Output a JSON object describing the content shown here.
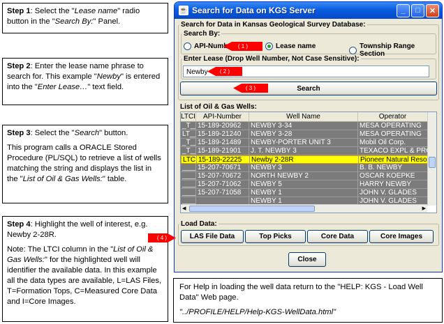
{
  "notes": {
    "step1": {
      "label": "Step 1",
      "text_a": ": Select the \"",
      "em1": "Lease name",
      "text_b": "\" radio button in the \"",
      "em2": "Search By:",
      "text_c": "\" Panel."
    },
    "step2": {
      "label": "Step 2",
      "text_a": ": Enter the lease name phrase to search for. This example \"",
      "em1": "Newby",
      "text_b": "\" is entered into the \"",
      "em2": "Enter Lease…",
      "text_c": "\" text field."
    },
    "step3": {
      "label": "Step 3",
      "text_a": ": Select the \"",
      "em1": "Search",
      "text_b": "\" button.",
      "para2_a": "This program calls a ORACLE Stored Procedure (PL/SQL) to retrieve a list of wells matching the string and displays the list in the \"",
      "para2_em": "List of Oil & Gas Wells:",
      "para2_b": "\" table."
    },
    "step4": {
      "label": "Step 4",
      "text_a": ": Highlight the well of interest, e.g. Newby 2-28R.",
      "para2_a": "Note: The LTCI column in the \"",
      "para2_em": "List of Oil & Gas Wells:",
      "para2_b": "\" for the highlighted well will identifier the available data. In this example all the data types are available, L=LAS Files, T=Formation Tops, C=Measured Core Data and I=Core Images."
    }
  },
  "window": {
    "title": "Search for Data on KGS Server",
    "main_group_label": "Search for Data in Kansas Geological Survey Database:",
    "search_by_label": "Search By:",
    "radio_api": "API-Number",
    "radio_lease": "Lease name",
    "radio_township": "Township Range Section",
    "selected_radio": "Lease name",
    "enter_lease_label": "Enter Lease (Drop Well Number, Not Case Sensitive):",
    "lease_value": "Newby",
    "search_button": "Search",
    "list_label": "List of Oil & Gas Wells:",
    "columns": [
      "LTCI",
      "API-Number",
      "Well Name",
      "Operator"
    ],
    "rows": [
      [
        "_T__",
        "15-189-20962",
        "NEWBY 3-34",
        "MESA OPERATING"
      ],
      [
        "LT__",
        "15-189-21240",
        "NEWBY 3-28",
        "MESA OPERATING"
      ],
      [
        "_T__",
        "15-189-21489",
        "NEWBY-PORTER UNIT 3",
        "Mobil Oil Corp."
      ],
      [
        "_T__",
        "15-189-21901",
        "J. T. NEWBY 3",
        "TEXACO EXPL & PROD"
      ],
      [
        "LTCI",
        "15-189-22225",
        "Newby 2-28R",
        "Pioneer Natural Resou"
      ],
      [
        "____",
        "15-207-70671",
        "NEWBY 3",
        "B. B. NEWBY"
      ],
      [
        "____",
        "15-207-70672",
        "NORTH NEWBY 2",
        "OSCAR KOEPKE"
      ],
      [
        "____",
        "15-207-71062",
        "NEWBY 5",
        "HARRY NEWBY"
      ],
      [
        "____",
        "15-207-71058",
        "NEWBY 1",
        "JOHN V. GLADES"
      ],
      [
        "____",
        "",
        "NEWBY 1",
        "JOHN V. GLADES"
      ]
    ],
    "selected_row": 4,
    "load_data_label": "Load Data:",
    "load_buttons": [
      "LAS File Data",
      "Top Picks",
      "Core Data",
      "Core Images"
    ],
    "close_button": "Close"
  },
  "markers": [
    "( 1 )",
    "( 2 )",
    "( 3 )",
    "( 4 )"
  ],
  "help": {
    "line1": "For Help in loading the well data return to the \"HELP: KGS - Load Well Data\" Web page.",
    "line2": "\"../PROFILE/HELP/Help-KGS-WellData.html\""
  },
  "colors": {
    "marker": "#ff0000",
    "selected_row": "#ffff00",
    "row_bg": "#7b7b7b",
    "titlebar": "#0a5de0"
  }
}
